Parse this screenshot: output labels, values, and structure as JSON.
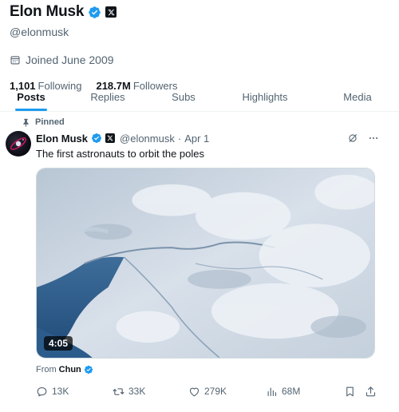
{
  "profile": {
    "name": "Elon Musk",
    "handle": "@elonmusk",
    "joined": "Joined June 2009",
    "following_count": "1,101",
    "following_label": "Following",
    "followers_count": "218.7M",
    "followers_label": "Followers"
  },
  "tabs": [
    {
      "label": "Posts",
      "active": true
    },
    {
      "label": "Replies",
      "active": false
    },
    {
      "label": "Subs",
      "active": false
    },
    {
      "label": "Highlights",
      "active": false
    },
    {
      "label": "Media",
      "active": false
    }
  ],
  "tweet": {
    "pinned_label": "Pinned",
    "author_name": "Elon Musk",
    "author_handle": "@elonmusk",
    "separator": "·",
    "date": "Apr 1",
    "text": "The first astronauts to orbit the poles",
    "video_duration": "4:05",
    "from_prefix": "From",
    "from_name": "Chun",
    "replies": "13K",
    "reposts": "33K",
    "likes": "279K",
    "views": "68M"
  },
  "colors": {
    "accent": "#1d9bf0",
    "text_primary": "#0f1419",
    "text_secondary": "#536471"
  },
  "icons": [
    "verified-badge-icon",
    "x-logo-icon",
    "calendar-icon",
    "pin-icon",
    "grok-icon",
    "more-icon",
    "reply-icon",
    "retweet-icon",
    "like-icon",
    "views-icon",
    "bookmark-icon",
    "share-icon"
  ]
}
